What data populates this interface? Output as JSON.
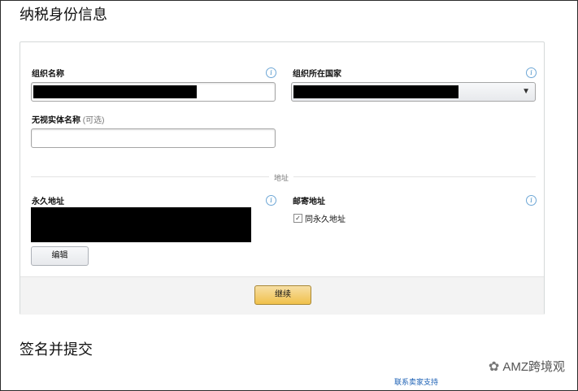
{
  "tax_section": {
    "title": "纳税身份信息"
  },
  "form": {
    "org_name": {
      "label": "组织名称",
      "value": ""
    },
    "org_country": {
      "label": "组织所在国家",
      "value": ""
    },
    "disregarded_entity": {
      "label": "无视实体名称",
      "optional_note": "(可选)",
      "value": ""
    }
  },
  "address": {
    "divider_label": "地址",
    "permanent": {
      "label": "永久地址",
      "edit_button": "编辑"
    },
    "mailing": {
      "label": "邮寄地址",
      "same_checkbox_label": "同永久地址",
      "same_checked": true
    }
  },
  "actions": {
    "continue_label": "继续"
  },
  "sign_section": {
    "title": "签名并提交"
  },
  "footer": {
    "contact_link": "联系卖家支持"
  },
  "watermark": {
    "text": "AMZ跨境观"
  },
  "icons": {
    "info": "info-icon",
    "dropdown": "chevron-down-icon",
    "wechat": "wechat-icon"
  },
  "colors": {
    "primary_button": "#f0c14b",
    "link": "#1a5fb4",
    "info": "#3b88c3"
  }
}
